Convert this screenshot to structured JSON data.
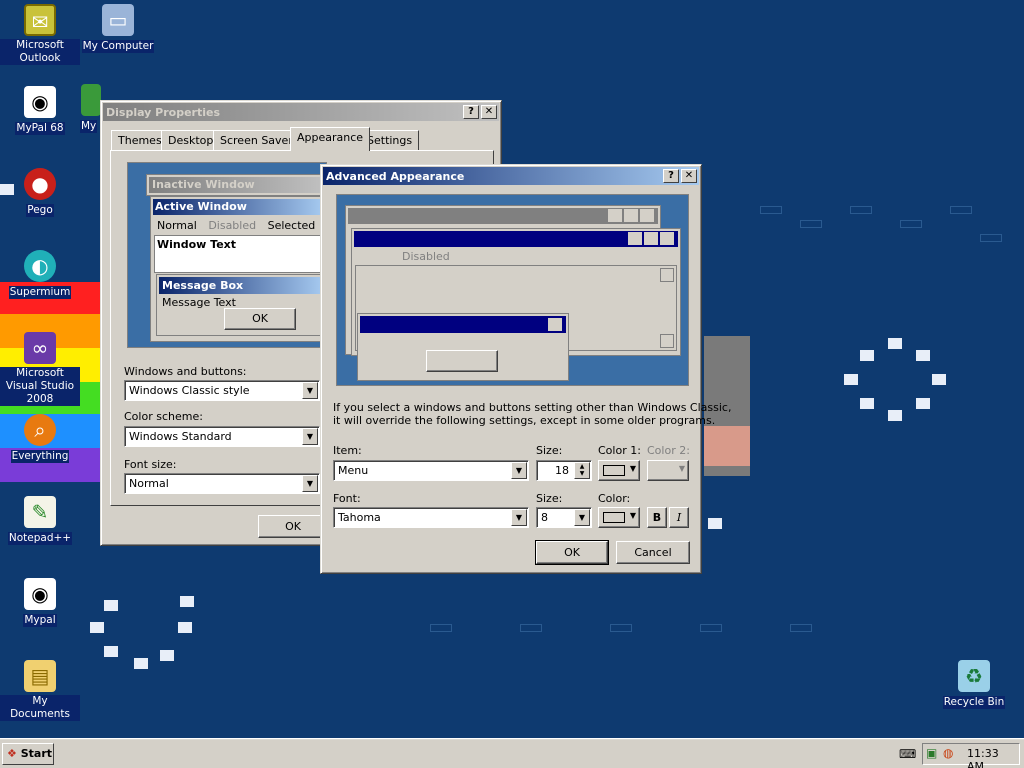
{
  "desktop": {
    "icons": [
      {
        "label": "Microsoft Outlook",
        "icon": "outlook-icon"
      },
      {
        "label": "My Computer",
        "icon": "computer-icon"
      },
      {
        "label": "MyPal 68",
        "icon": "raccoon-icon"
      },
      {
        "label": "Pego",
        "icon": "pego-icon"
      },
      {
        "label": "Supermium",
        "icon": "supermium-icon"
      },
      {
        "label": "Microsoft Visual Studio 2008",
        "icon": "visual-studio-icon"
      },
      {
        "label": "Everything",
        "icon": "search-icon"
      },
      {
        "label": "Notepad++",
        "icon": "notepad-icon"
      },
      {
        "label": "Mypal",
        "icon": "raccoon-icon"
      },
      {
        "label": "My Documents",
        "icon": "folder-icon"
      },
      {
        "label": "Recycle Bin",
        "icon": "recycle-bin-icon"
      }
    ],
    "partial_icon_label": "My"
  },
  "display_properties": {
    "title": "Display Properties",
    "help_glyph": "?",
    "close_glyph": "✕",
    "tabs": [
      "Themes",
      "Desktop",
      "Screen Saver",
      "Appearance",
      "Settings"
    ],
    "selected_tab": "Appearance",
    "preview": {
      "inactive_window": "Inactive Window",
      "active_window": "Active Window",
      "menu_normal": "Normal",
      "menu_disabled": "Disabled",
      "menu_selected": "Selected",
      "window_text": "Window Text",
      "message_box": "Message Box",
      "message_text": "Message Text",
      "ok": "OK"
    },
    "windows_buttons_label": "Windows and buttons:",
    "windows_buttons_value": "Windows Classic style",
    "color_scheme_label": "Color scheme:",
    "color_scheme_value": "Windows Standard",
    "font_size_label": "Font size:",
    "font_size_value": "Normal",
    "ok": "OK"
  },
  "advanced_appearance": {
    "title": "Advanced Appearance",
    "help_glyph": "?",
    "close_glyph": "✕",
    "preview_disabled": "Disabled",
    "note_line1": "If you select a windows and buttons setting other than Windows Classic,",
    "note_line2": "it will override the following settings, except in some older programs.",
    "item_label": "Item:",
    "item_value": "Menu",
    "item_size_label": "Size:",
    "item_size_value": "18",
    "color1_label": "Color 1:",
    "color2_label": "Color 2:",
    "font_label": "Font:",
    "font_value": "Tahoma",
    "font_size_label": "Size:",
    "font_size_value": "8",
    "font_color_label": "Color:",
    "bold": "B",
    "italic": "I",
    "ok": "OK",
    "cancel": "Cancel"
  },
  "taskbar": {
    "start": "Start",
    "clock": "11:33 AM"
  },
  "colors": {
    "desktop": "#0e3a70",
    "title_active": "#0a246a",
    "face": "#d4d0c8"
  }
}
